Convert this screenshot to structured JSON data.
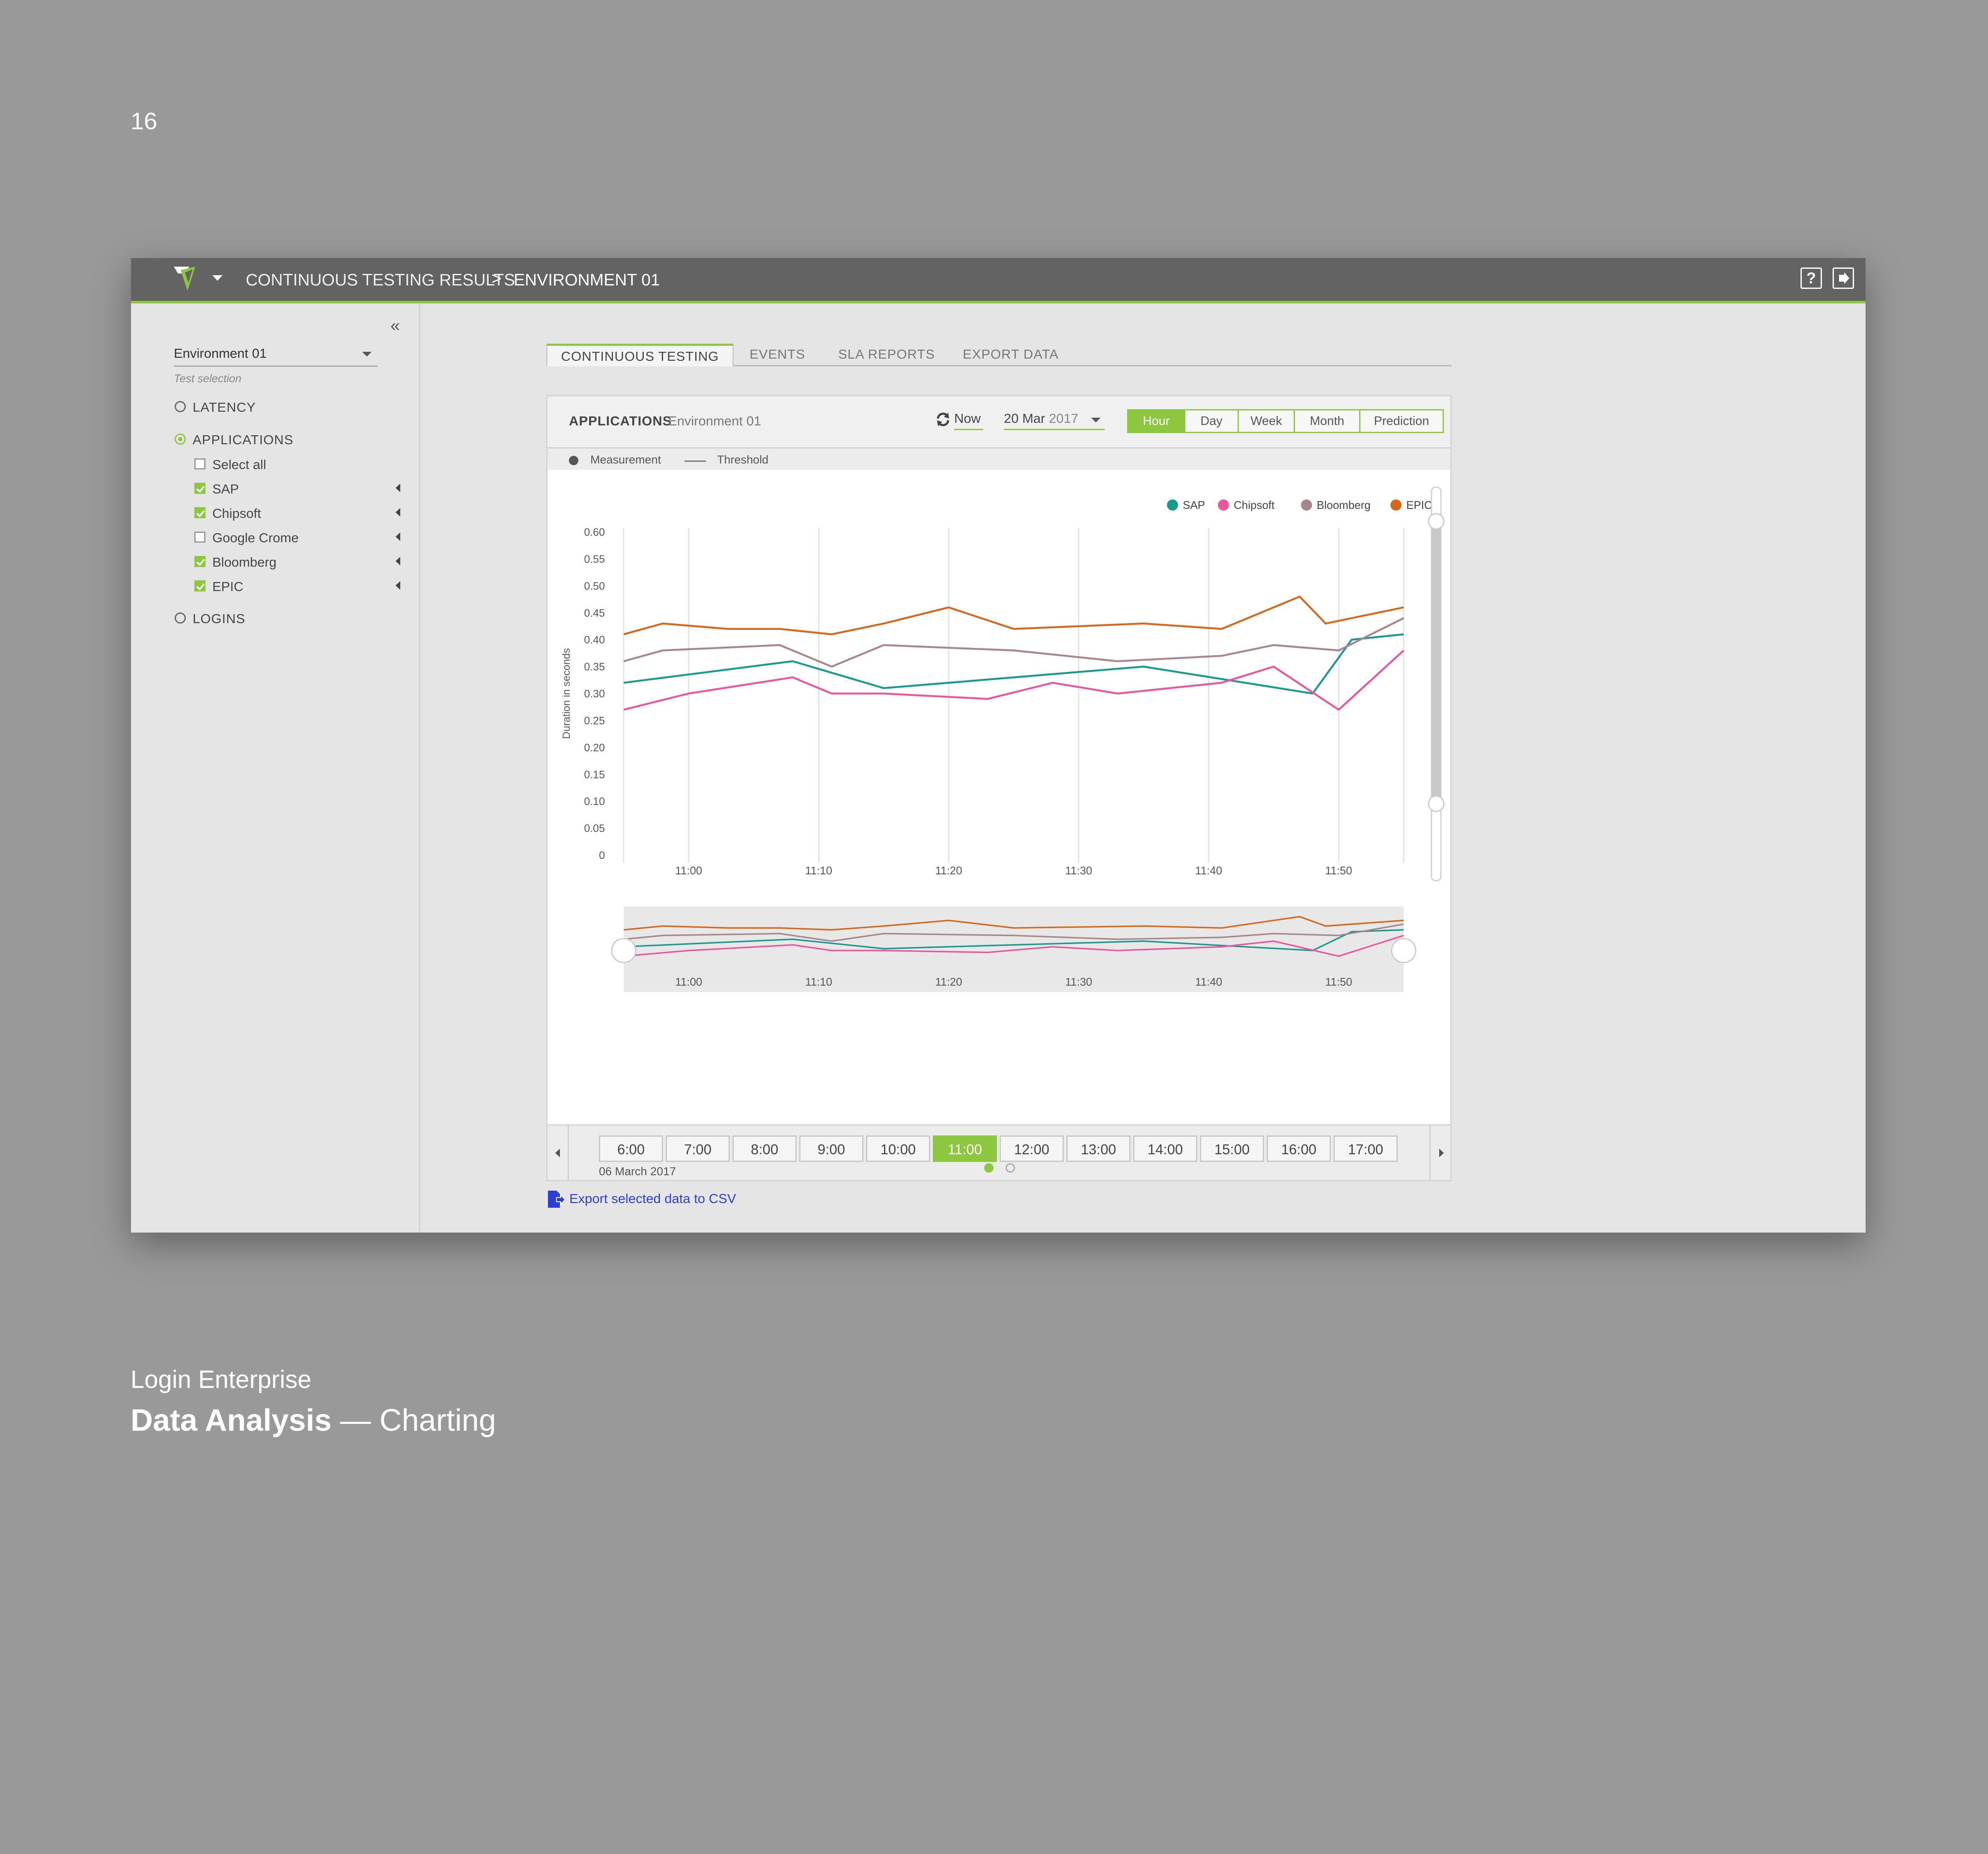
{
  "page_number": "16",
  "topbar": {
    "breadcrumb_1": "CONTINUOUS TESTING RESULTS",
    "breadcrumb_sep": ">",
    "breadcrumb_2": "ENVIRONMENT 01",
    "help_icon": "?",
    "icons": [
      "logo-icon",
      "dropdown-caret-icon",
      "help-icon",
      "logout-icon"
    ]
  },
  "sidebar": {
    "collapse_glyph": "«",
    "env_select_value": "Environment 01",
    "env_select_help": "Test selection",
    "options": [
      {
        "label": "LATENCY",
        "selected": false
      },
      {
        "label": "APPLICATIONS",
        "selected": true
      },
      {
        "label": "LOGINS",
        "selected": false
      }
    ],
    "applications": [
      {
        "label": "Select all",
        "checked": false
      },
      {
        "label": "SAP",
        "checked": true
      },
      {
        "label": "Chipsoft",
        "checked": true
      },
      {
        "label": "Google Crome",
        "checked": false
      },
      {
        "label": "Bloomberg",
        "checked": true
      },
      {
        "label": "EPIC",
        "checked": true
      }
    ]
  },
  "tabs": [
    {
      "label": "CONTINUOUS TESTING",
      "active": true
    },
    {
      "label": "EVENTS",
      "active": false
    },
    {
      "label": "SLA REPORTS",
      "active": false
    },
    {
      "label": "EXPORT DATA",
      "active": false
    }
  ],
  "panel": {
    "title": "APPLICATIONS",
    "subtitle": "Environment 01",
    "now_label": "Now",
    "date_day": "20 Mar",
    "date_year": "2017",
    "ranges": [
      {
        "label": "Hour",
        "active": true
      },
      {
        "label": "Day",
        "active": false
      },
      {
        "label": "Week",
        "active": false
      },
      {
        "label": "Month",
        "active": false
      },
      {
        "label": "Prediction",
        "active": false
      }
    ],
    "legend_measurement": "Measurement",
    "legend_threshold": "Threshold"
  },
  "chart_data": {
    "type": "line",
    "ylabel": "Duration in seconds",
    "xlabel": "",
    "ylim": [
      0,
      0.6
    ],
    "yticks": [
      "0",
      "0.05",
      "0.10",
      "0.15",
      "0.20",
      "0.25",
      "0.30",
      "0.35",
      "0.40",
      "0.45",
      "0.50",
      "0.55",
      "0.60"
    ],
    "xticks": [
      "11:00",
      "11:10",
      "11:20",
      "11:30",
      "11:40",
      "11:50"
    ],
    "x": [
      0,
      1,
      2,
      3,
      4,
      5,
      6,
      7,
      8,
      9,
      10,
      11,
      12,
      13,
      14,
      15,
      16,
      17,
      18,
      19,
      20,
      21,
      22,
      23,
      24,
      25,
      26,
      27,
      28,
      29,
      30,
      31,
      32,
      33,
      34,
      35,
      36,
      37,
      38,
      39,
      40,
      41,
      42,
      43,
      44,
      45,
      46,
      47,
      48,
      49,
      50,
      51,
      52,
      53,
      54,
      55,
      56,
      57,
      58,
      59,
      60
    ],
    "x_start": "10:55",
    "x_step_minutes": 1,
    "legend_position": "top-right",
    "series": [
      {
        "name": "SAP",
        "color": "#1a9a8e",
        "points": [
          [
            0,
            0.32
          ],
          [
            13,
            0.36
          ],
          [
            20,
            0.31
          ],
          [
            40,
            0.35
          ],
          [
            53,
            0.3
          ],
          [
            56,
            0.4
          ],
          [
            60,
            0.41
          ]
        ]
      },
      {
        "name": "Chipsoft",
        "color": "#e8579e",
        "points": [
          [
            0,
            0.27
          ],
          [
            5,
            0.3
          ],
          [
            13,
            0.33
          ],
          [
            16,
            0.3
          ],
          [
            20,
            0.3
          ],
          [
            28,
            0.29
          ],
          [
            33,
            0.32
          ],
          [
            38,
            0.3
          ],
          [
            46,
            0.32
          ],
          [
            50,
            0.35
          ],
          [
            55,
            0.27
          ],
          [
            60,
            0.38
          ]
        ]
      },
      {
        "name": "Bloomberg",
        "color": "#a8868e",
        "points": [
          [
            0,
            0.36
          ],
          [
            3,
            0.38
          ],
          [
            12,
            0.39
          ],
          [
            16,
            0.35
          ],
          [
            20,
            0.39
          ],
          [
            30,
            0.38
          ],
          [
            38,
            0.36
          ],
          [
            46,
            0.37
          ],
          [
            50,
            0.39
          ],
          [
            55,
            0.38
          ],
          [
            60,
            0.44
          ]
        ]
      },
      {
        "name": "EPIC",
        "color": "#d2691e",
        "points": [
          [
            0,
            0.41
          ],
          [
            3,
            0.43
          ],
          [
            8,
            0.42
          ],
          [
            12,
            0.42
          ],
          [
            16,
            0.41
          ],
          [
            20,
            0.43
          ],
          [
            25,
            0.46
          ],
          [
            30,
            0.42
          ],
          [
            40,
            0.43
          ],
          [
            46,
            0.42
          ],
          [
            52,
            0.48
          ],
          [
            54,
            0.43
          ],
          [
            60,
            0.46
          ]
        ]
      }
    ],
    "navigator": {
      "xticks": [
        "11:00",
        "11:10",
        "11:20",
        "11:30",
        "11:40",
        "11:50"
      ]
    }
  },
  "timeline": {
    "hours": [
      "6:00",
      "7:00",
      "8:00",
      "9:00",
      "10:00",
      "11:00",
      "12:00",
      "13:00",
      "14:00",
      "15:00",
      "16:00",
      "17:00"
    ],
    "active_hour": "11:00",
    "date_label": "06 March 2017",
    "pages": 2,
    "active_page": 1
  },
  "export_label": "Export selected data to CSV",
  "footer": {
    "brand": "Login Enterprise",
    "title_bold": "Data Analysis",
    "title_rest": " — Charting"
  },
  "colors": {
    "accent": "#8dc63f",
    "topbar": "#636363",
    "background": "#999999",
    "link": "#2b3fd6"
  }
}
